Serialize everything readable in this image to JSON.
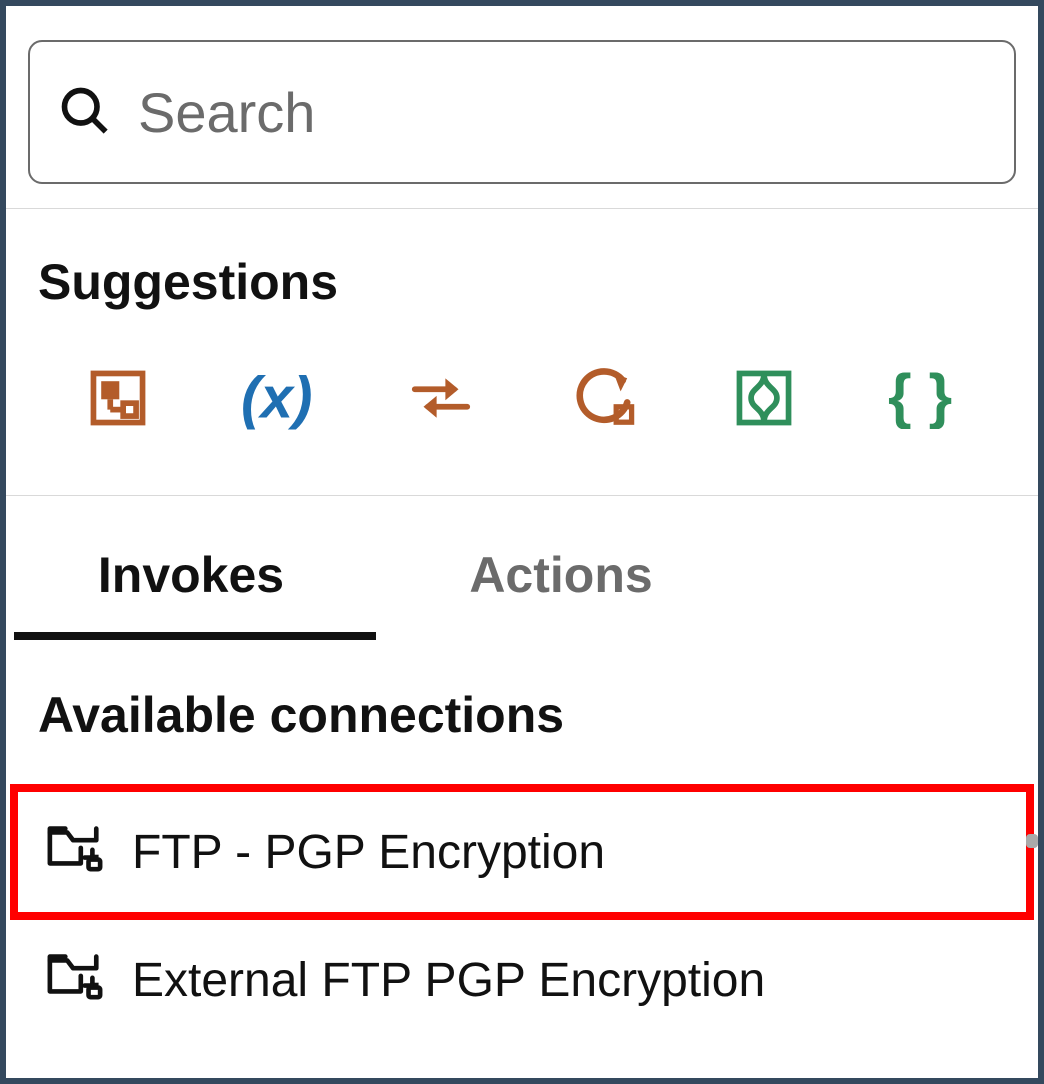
{
  "search": {
    "placeholder": "Search",
    "value": ""
  },
  "suggestions": {
    "title": "Suggestions",
    "items": [
      {
        "name": "map-icon",
        "color": "#b35c2a"
      },
      {
        "name": "variable-icon",
        "color": "#1f6fb2"
      },
      {
        "name": "swap-icon",
        "color": "#b35c2a"
      },
      {
        "name": "loop-icon",
        "color": "#b35c2a"
      },
      {
        "name": "integration-icon",
        "color": "#2f8f5b"
      },
      {
        "name": "braces-icon",
        "color": "#2f8f5b"
      }
    ]
  },
  "tabs": {
    "items": [
      {
        "label": "Invokes",
        "active": true
      },
      {
        "label": "Actions",
        "active": false
      }
    ]
  },
  "connections": {
    "title": "Available connections",
    "items": [
      {
        "label": "FTP - PGP Encryption",
        "highlight": true
      },
      {
        "label": "External FTP PGP Encryption",
        "highlight": false
      }
    ]
  }
}
